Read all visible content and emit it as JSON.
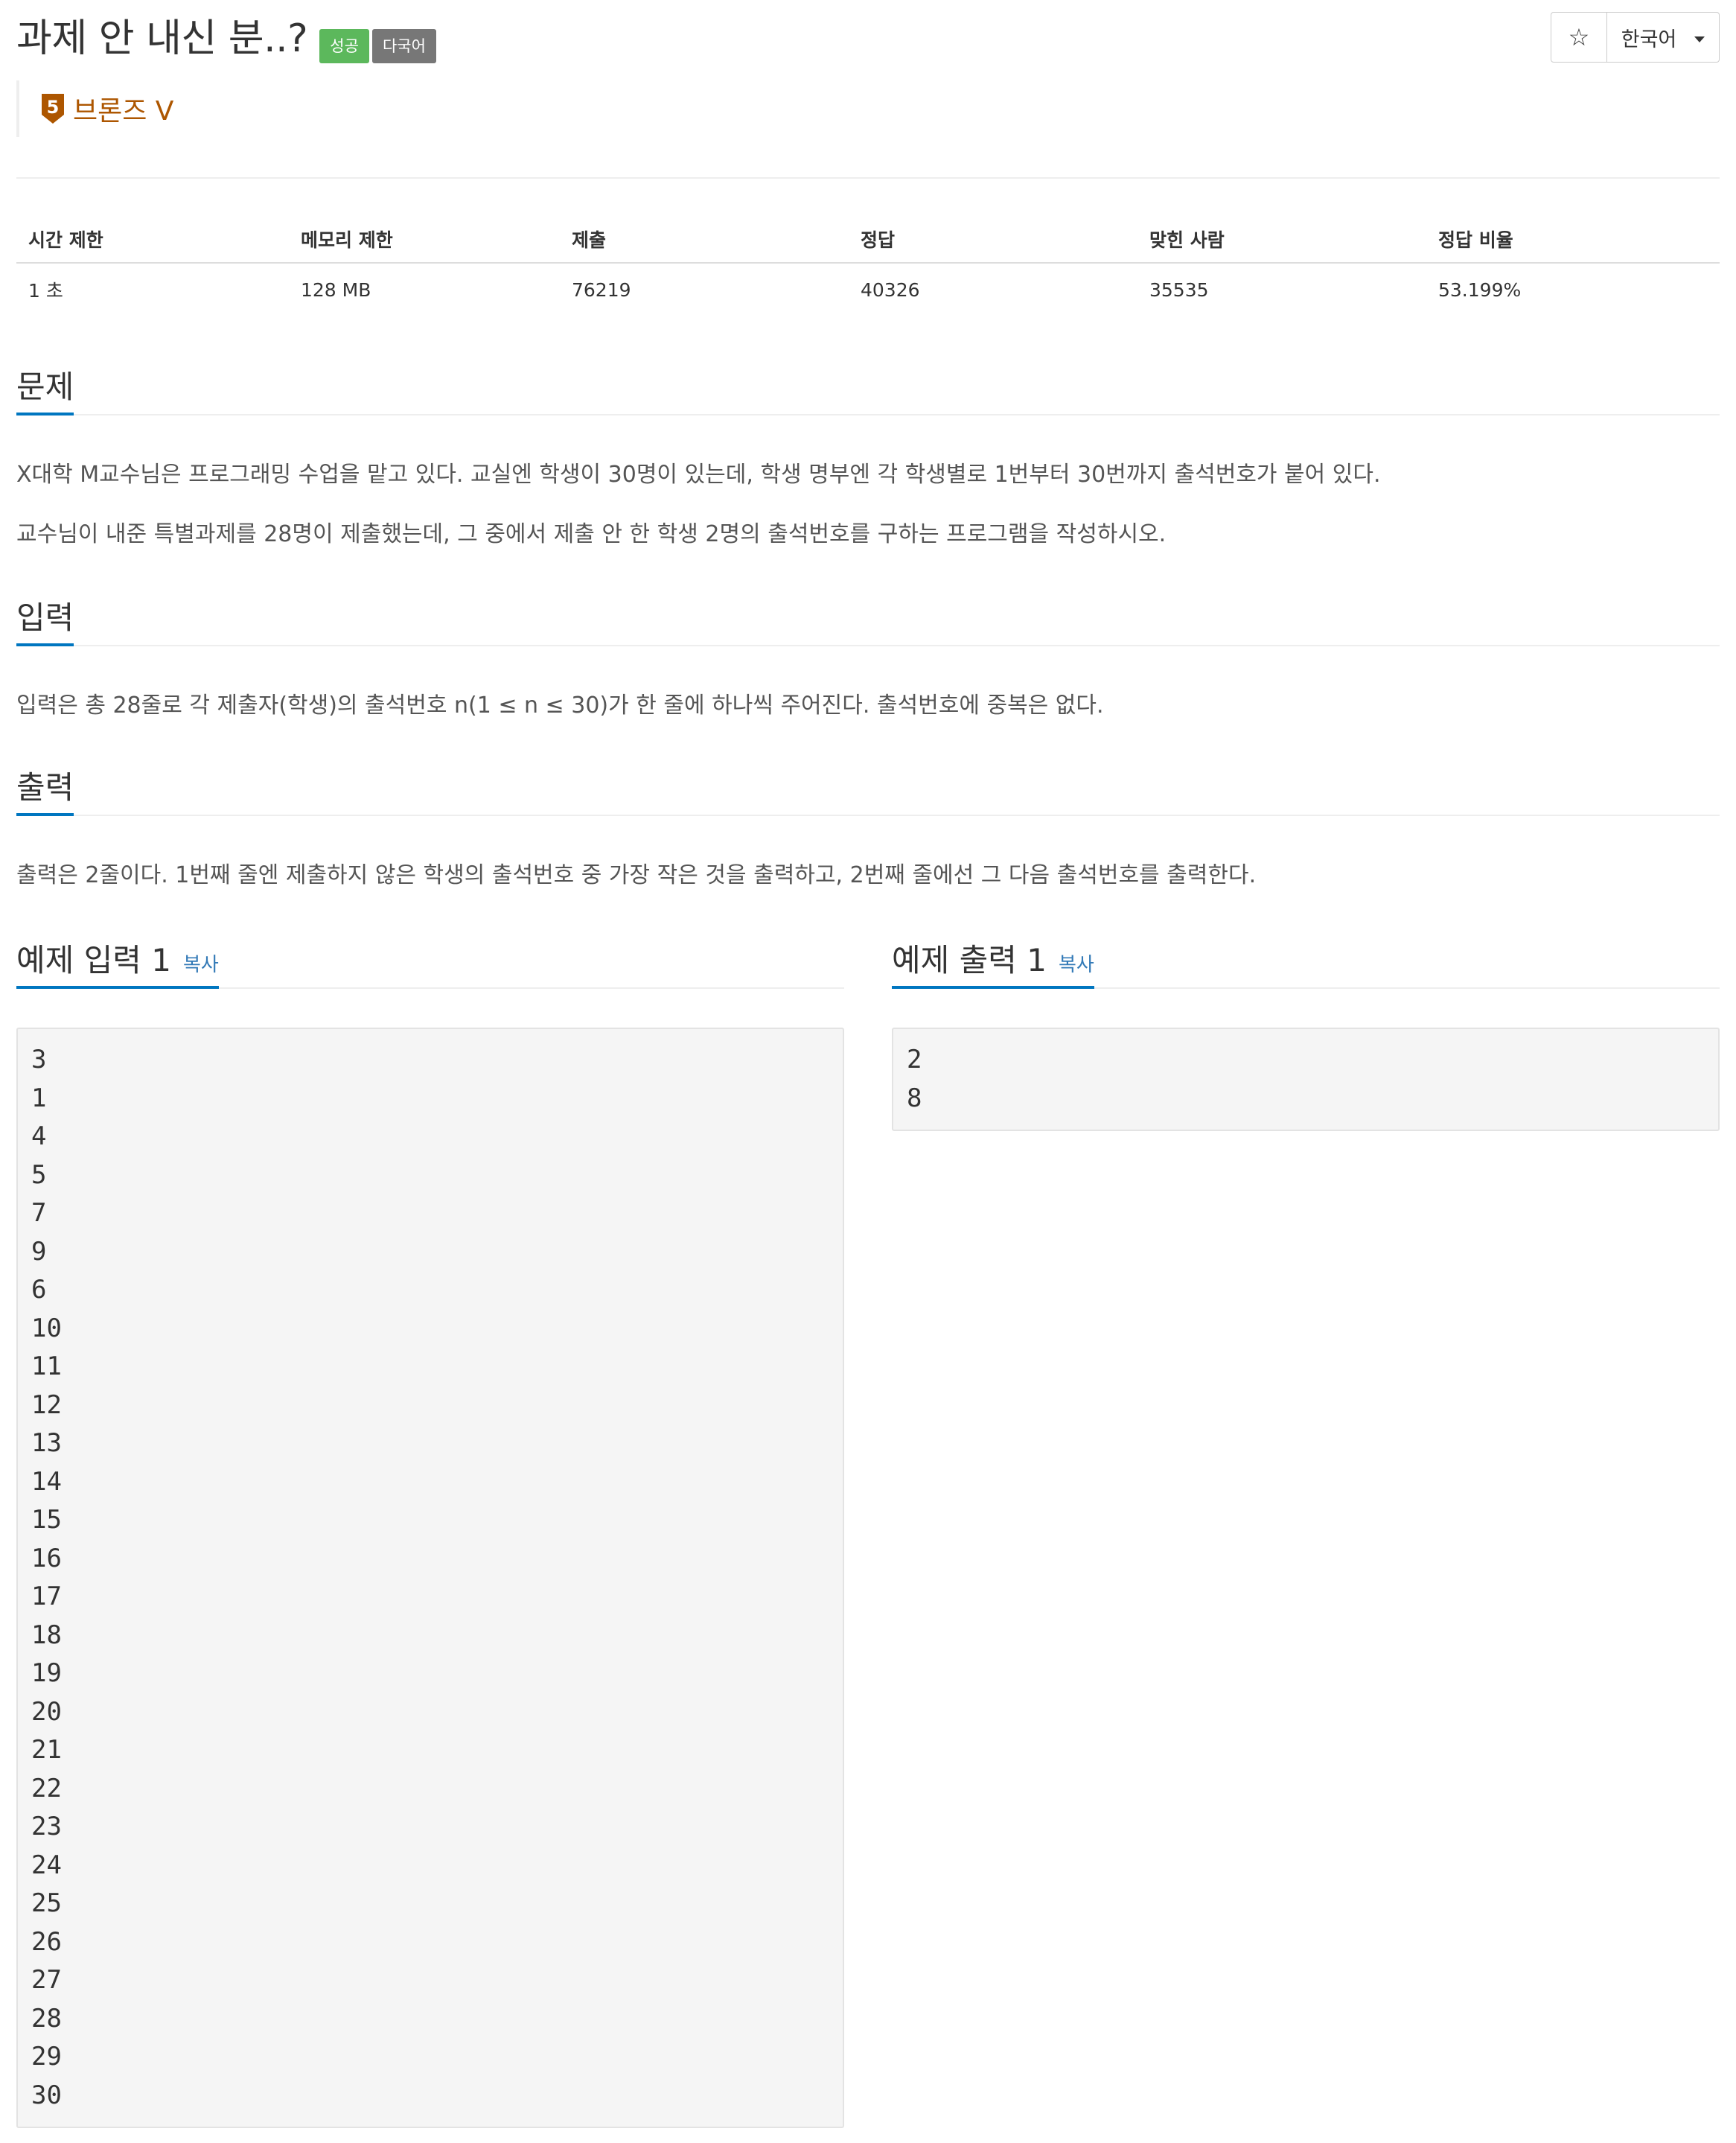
{
  "problem": {
    "title": "과제 안 내신 분..?",
    "labels": {
      "success": "성공",
      "multilang": "다국어"
    },
    "tier": {
      "text": "브론즈 V",
      "level": "5"
    }
  },
  "toolbar": {
    "star_icon": "☆",
    "language": "한국어"
  },
  "colors": {
    "accent": "#0076c0",
    "tier": "#ad5600",
    "success": "#5cb85c",
    "label_gray": "#777777",
    "link": "#337ab7"
  },
  "stats": {
    "headers": [
      "시간 제한",
      "메모리 제한",
      "제출",
      "정답",
      "맞힌 사람",
      "정답 비율"
    ],
    "values": [
      "1 초",
      "128 MB",
      "76219",
      "40326",
      "35535",
      "53.199%"
    ]
  },
  "description": {
    "heading": "문제",
    "paragraphs": [
      "X대학 M교수님은 프로그래밍 수업을 맡고 있다. 교실엔 학생이 30명이 있는데, 학생 명부엔 각 학생별로 1번부터 30번까지 출석번호가 붙어 있다.",
      "교수님이 내준 특별과제를 28명이 제출했는데, 그 중에서 제출 안 한 학생 2명의 출석번호를 구하는 프로그램을 작성하시오."
    ]
  },
  "input": {
    "heading": "입력",
    "text": "입력은 총 28줄로 각 제출자(학생)의 출석번호 n(1 ≤ n ≤ 30)가 한 줄에 하나씩 주어진다. 출석번호에 중복은 없다."
  },
  "output": {
    "heading": "출력",
    "text": "출력은 2줄이다. 1번째 줄엔 제출하지 않은 학생의 출석번호 중 가장 작은 것을 출력하고, 2번째 줄에선 그 다음 출석번호를 출력한다."
  },
  "sample_input": {
    "heading": "예제 입력 1",
    "copy": "복사",
    "content": "3\n1\n4\n5\n7\n9\n6\n10\n11\n12\n13\n14\n15\n16\n17\n18\n19\n20\n21\n22\n23\n24\n25\n26\n27\n28\n29\n30"
  },
  "sample_output": {
    "heading": "예제 출력 1",
    "copy": "복사",
    "content": "2\n8"
  }
}
